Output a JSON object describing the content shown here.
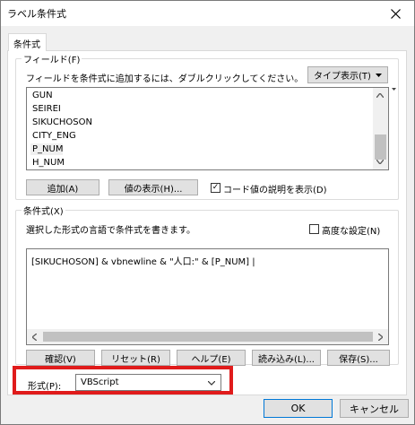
{
  "window": {
    "title": "ラベル条件式"
  },
  "tabs": [
    {
      "label": "条件式"
    }
  ],
  "fields_group": {
    "legend": "フィールド(F)",
    "instruction": "フィールドを条件式に追加するには、ダブルクリックしてください。",
    "type_display_label": "タイプ表示(T)",
    "items": [
      "GUN",
      "SEIREI",
      "SIKUCHOSON",
      "CITY_ENG",
      "P_NUM",
      "H_NUM"
    ],
    "selected_item": "P_NUM",
    "add_button": "追加(A)",
    "show_values_button": "値の表示(H)...",
    "show_code_desc_label": "コード値の説明を表示(D)",
    "show_code_desc_checked": true
  },
  "expression_group": {
    "legend": "条件式(X)",
    "instruction": "選択した形式の言語で条件式を書きます。",
    "advanced_label": "高度な設定(N)",
    "advanced_checked": false,
    "expression_text": "[SIKUCHOSON] & vbnewline & \"人口:\" & [P_NUM] |",
    "verify_button": "確認(V)",
    "reset_button": "リセット(R)",
    "help_button": "ヘルプ(E)",
    "load_button": "読み込み(L)...",
    "save_button": "保存(S)..."
  },
  "format": {
    "label": "形式(P):",
    "value": "VBScript"
  },
  "footer": {
    "ok_button": "OK",
    "cancel_button": "キャンセル"
  },
  "colors": {
    "highlight": "#e01b1b",
    "selected_bg": "#f0f0f0"
  }
}
